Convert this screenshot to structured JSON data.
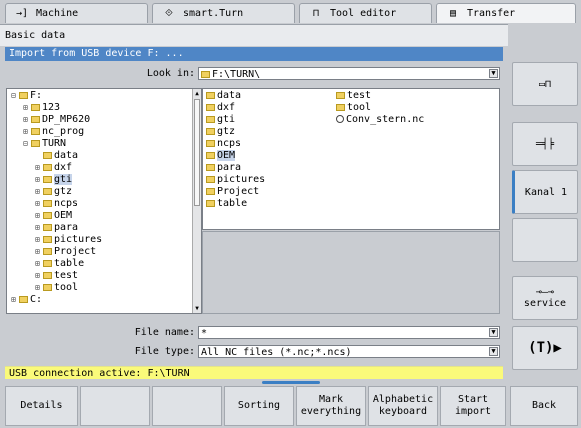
{
  "tabs": [
    {
      "icon": "→]",
      "label": "Machine"
    },
    {
      "icon": "⟐",
      "label": "smart.Turn"
    },
    {
      "icon": "⊓",
      "label": "Tool editor"
    },
    {
      "icon": "▤",
      "label": "Transfer"
    }
  ],
  "header": {
    "basic": "Basic data"
  },
  "dialog": {
    "title": "Import from USB device F: ...",
    "look_in_label": "Look in:",
    "look_in_value": "F:\\TURN\\",
    "file_name_label": "File name:",
    "file_name_value": "*",
    "file_type_label": "File type:",
    "file_type_value": "All NC files (*.nc;*.ncs)"
  },
  "tree": [
    {
      "label": "F:",
      "level": 0,
      "exp": "⊟"
    },
    {
      "label": "123",
      "level": 1,
      "exp": "⊞"
    },
    {
      "label": "DP_MP620",
      "level": 1,
      "exp": "⊞"
    },
    {
      "label": "nc_prog",
      "level": 1,
      "exp": "⊞"
    },
    {
      "label": "TURN",
      "level": 1,
      "exp": "⊟"
    },
    {
      "label": "data",
      "level": 2,
      "exp": ""
    },
    {
      "label": "dxf",
      "level": 2,
      "exp": "⊞"
    },
    {
      "label": "gti",
      "level": 2,
      "exp": "⊞",
      "selected": true
    },
    {
      "label": "gtz",
      "level": 2,
      "exp": "⊞"
    },
    {
      "label": "ncps",
      "level": 2,
      "exp": "⊞"
    },
    {
      "label": "OEM",
      "level": 2,
      "exp": "⊞"
    },
    {
      "label": "para",
      "level": 2,
      "exp": "⊞"
    },
    {
      "label": "pictures",
      "level": 2,
      "exp": "⊞"
    },
    {
      "label": "Project",
      "level": 2,
      "exp": "⊞"
    },
    {
      "label": "table",
      "level": 2,
      "exp": "⊞"
    },
    {
      "label": "test",
      "level": 2,
      "exp": "⊞"
    },
    {
      "label": "tool",
      "level": 2,
      "exp": "⊞"
    },
    {
      "label": "C:",
      "level": 0,
      "exp": "⊞"
    }
  ],
  "files_col1": [
    "data",
    "dxf",
    "gti",
    "gtz",
    "ncps",
    "OEM",
    "para",
    "pictures",
    "Project",
    "table"
  ],
  "files_col2": [
    "test",
    "tool",
    "Conv_stern.nc"
  ],
  "status": "USB connection active: F:\\TURN",
  "right_softkeys": [
    "",
    "",
    "Kanal 1",
    "",
    "service",
    ""
  ],
  "bottom_softkeys": [
    "Details",
    "",
    "",
    "Sorting",
    "Mark\neverything",
    "Alphabetic\nkeyboard",
    "Start\nimport",
    "Back"
  ]
}
